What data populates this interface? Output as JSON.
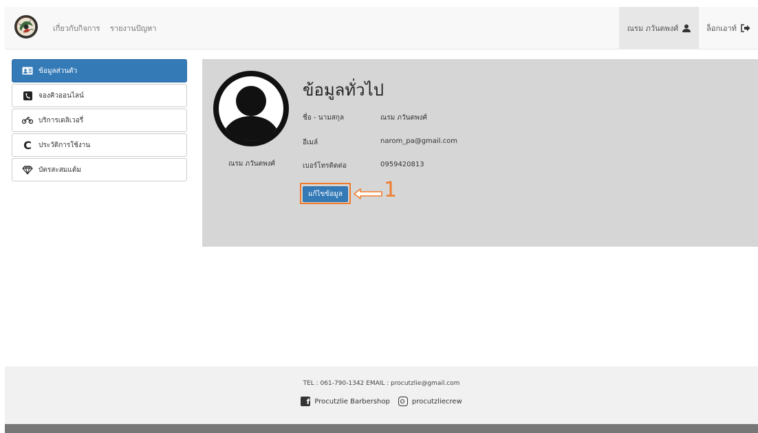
{
  "navbar": {
    "links": [
      "เกี่ยวกับกิจการ",
      "รายงานปัญหา"
    ],
    "user_name": "ณรม ภวันตพงศ์",
    "user_icon": "user-icon",
    "logout_label": "ล็อกเอาท์",
    "logout_icon": "sign-out-icon"
  },
  "sidebar": {
    "items": [
      {
        "label": "ข้อมูลส่วนตัว",
        "icon": "id-card-icon",
        "active": true
      },
      {
        "label": "จองคิวออนไลน์",
        "icon": "phone-icon",
        "active": false
      },
      {
        "label": "บริการเดลิเวอรี่",
        "icon": "motorcycle-icon",
        "active": false
      },
      {
        "label": "ประวัติการใช้งาน",
        "icon": "history-icon",
        "active": false
      },
      {
        "label": "บัตรสะสมแต้ม",
        "icon": "diamond-icon",
        "active": false
      }
    ]
  },
  "profile": {
    "name": "ณรม ภวันตพงศ์",
    "title": "ข้อมูลทั่วไป",
    "fields": [
      {
        "label": "ชื่อ - นามสกุล",
        "value": "ณรม ภวันตพงศ์"
      },
      {
        "label": "อีเมล์",
        "value": "narom_pa@gmail.com"
      },
      {
        "label": "เบอร์โทรติดต่อ",
        "value": "0959420813"
      }
    ],
    "edit_label": "แก้ไขข้อมูล"
  },
  "annotation": {
    "number": "1",
    "color": "#f07b2c"
  },
  "footer": {
    "contact": "TEL : 061-790-1342 EMAIL : procutzlie@gmail.com",
    "facebook": "Procutzlie Barbershop",
    "instagram": "procutzliecrew"
  },
  "colors": {
    "primary": "#337ab7",
    "panel": "#d6d6d6",
    "annotation": "#f07b2c"
  }
}
